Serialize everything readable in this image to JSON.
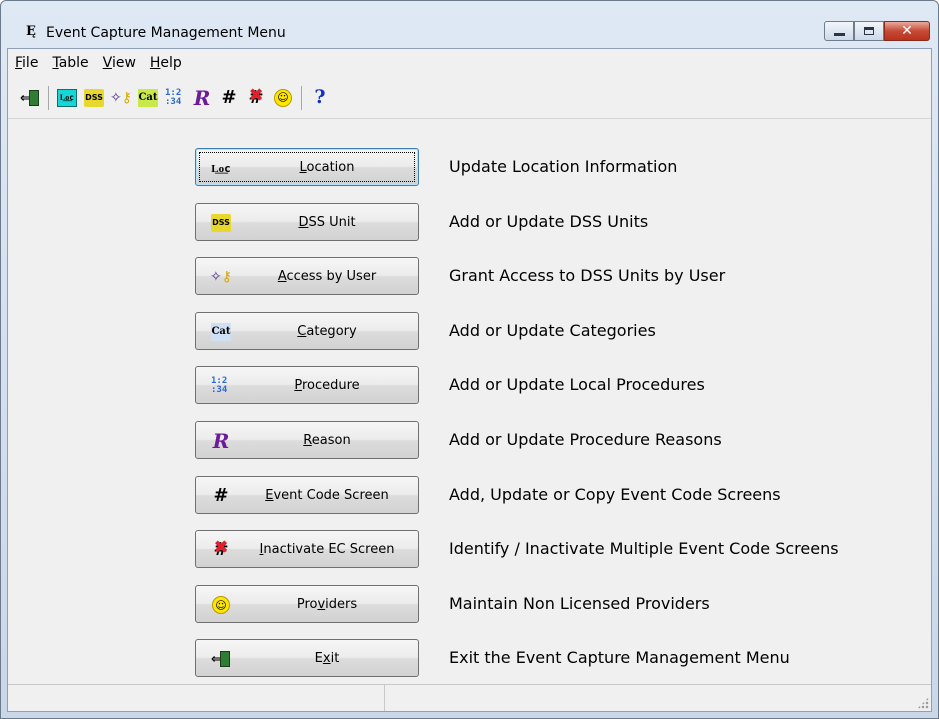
{
  "window": {
    "title": "Event Capture Management Menu",
    "app_icon_glyph": "Ę"
  },
  "menubar": {
    "items": [
      {
        "label": "File",
        "accel": "F"
      },
      {
        "label": "Table",
        "accel": "T"
      },
      {
        "label": "View",
        "accel": "V"
      },
      {
        "label": "Help",
        "accel": "H"
      }
    ]
  },
  "toolbar": {
    "icons": [
      "exit-icon",
      "location-icon",
      "dss-unit-icon",
      "access-by-user-icon",
      "category-icon",
      "procedure-icon",
      "reason-icon",
      "event-code-screen-icon",
      "inactivate-ec-screen-icon",
      "providers-icon",
      "help-icon"
    ]
  },
  "commands": [
    {
      "label": "Location",
      "accel_index": 0,
      "description": "Update Location Information",
      "icon": "location-icon"
    },
    {
      "label": "DSS Unit",
      "accel_index": 0,
      "description": "Add or Update DSS Units",
      "icon": "dss-unit-icon"
    },
    {
      "label": "Access by User",
      "accel_index": 0,
      "description": "Grant Access to DSS Units by User",
      "icon": "access-by-user-icon"
    },
    {
      "label": "Category",
      "accel_index": 0,
      "description": "Add or Update Categories",
      "icon": "category-icon"
    },
    {
      "label": "Procedure",
      "accel_index": 0,
      "description": "Add or Update Local Procedures",
      "icon": "procedure-icon"
    },
    {
      "label": "Reason",
      "accel_index": 0,
      "description": "Add or Update Procedure Reasons",
      "icon": "reason-icon"
    },
    {
      "label": "Event Code Screen",
      "accel_index": 0,
      "description": "Add, Update or Copy Event Code Screens",
      "icon": "event-code-screen-icon"
    },
    {
      "label": "Inactivate EC Screen",
      "accel_index": 0,
      "description": "Identify / Inactivate Multiple Event Code Screens",
      "icon": "inactivate-ec-screen-icon"
    },
    {
      "label": "Providers",
      "accel_index": 3,
      "description": "Maintain Non Licensed Providers",
      "icon": "providers-icon"
    },
    {
      "label": "Exit",
      "accel_index": 1,
      "description": "Exit the Event Capture Management Menu",
      "icon": "exit-icon"
    }
  ],
  "icon_glyphs": {
    "location": "L͟o͟c",
    "dss": "DSS",
    "category": "Cat",
    "procedure": "1:2 :34",
    "reason": "R",
    "grid": "#",
    "smile": "◡",
    "help": "?",
    "close": "✕",
    "exit_arrow": "⇐"
  }
}
